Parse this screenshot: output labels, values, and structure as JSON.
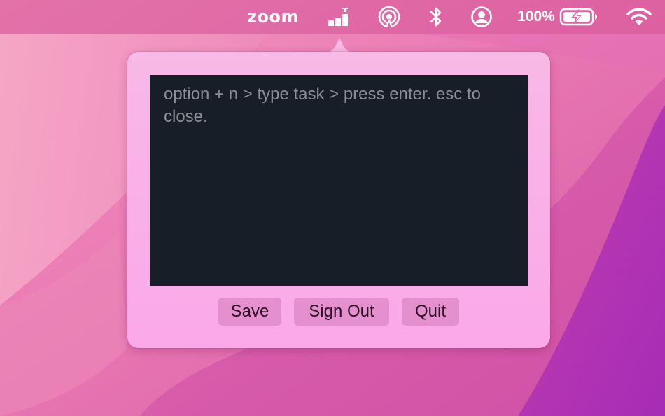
{
  "menubar": {
    "zoom_label": "zoom",
    "battery_percent": "100%",
    "icons": [
      "signal-bars-icon",
      "airdrop-icon",
      "bluetooth-icon",
      "user-account-icon",
      "battery-charging-icon",
      "wifi-icon"
    ]
  },
  "popover": {
    "task_input": {
      "value": "",
      "placeholder": "option + n > type task > press enter. esc to close."
    },
    "buttons": {
      "save": "Save",
      "sign_out": "Sign Out",
      "quit": "Quit"
    }
  },
  "colors": {
    "popover_background": "#f9b0e7",
    "editor_background": "#181e27",
    "placeholder_text": "#8a8e93",
    "button_background": "#d680be",
    "menubar_tint": "#d65296"
  }
}
